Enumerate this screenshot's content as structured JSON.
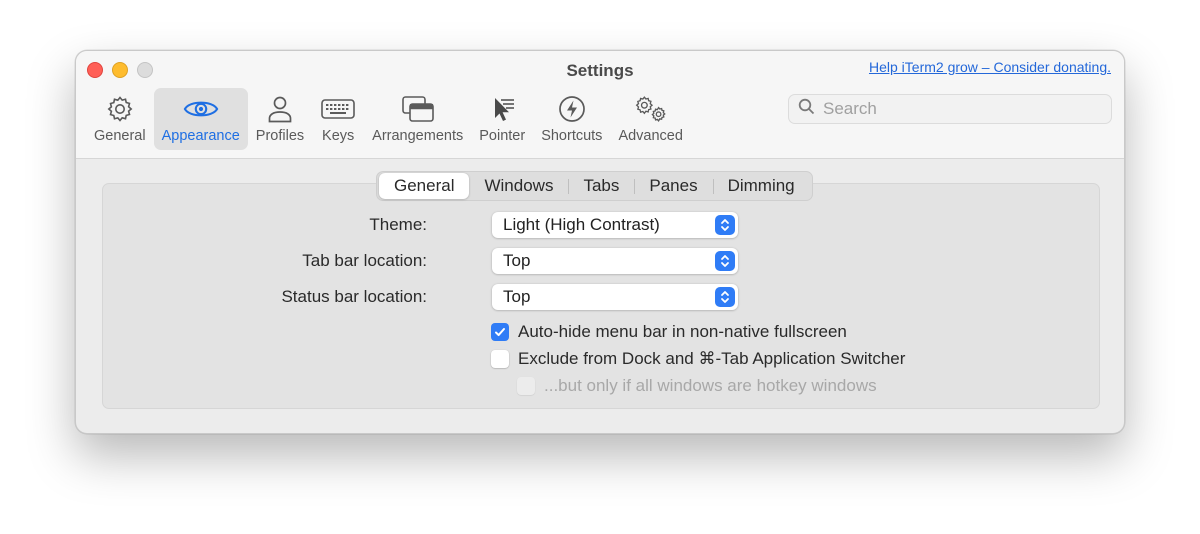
{
  "window": {
    "title": "Settings",
    "donate_link": "Help iTerm2 grow – Consider donating."
  },
  "toolbar": {
    "items": [
      {
        "label": "General",
        "icon": "gear-icon"
      },
      {
        "label": "Appearance",
        "icon": "eye-icon",
        "active": true
      },
      {
        "label": "Profiles",
        "icon": "person-icon"
      },
      {
        "label": "Keys",
        "icon": "keyboard-icon"
      },
      {
        "label": "Arrangements",
        "icon": "windows-icon"
      },
      {
        "label": "Pointer",
        "icon": "cursor-icon"
      },
      {
        "label": "Shortcuts",
        "icon": "bolt-icon"
      },
      {
        "label": "Advanced",
        "icon": "gears-icon"
      }
    ]
  },
  "search": {
    "placeholder": "Search",
    "value": ""
  },
  "tabs": {
    "items": [
      "General",
      "Windows",
      "Tabs",
      "Panes",
      "Dimming"
    ],
    "selected": "General"
  },
  "settings": {
    "theme": {
      "label": "Theme:",
      "value": "Light (High Contrast)"
    },
    "tab_bar": {
      "label": "Tab bar location:",
      "value": "Top"
    },
    "status_bar": {
      "label": "Status bar location:",
      "value": "Top"
    },
    "auto_hide": {
      "label": "Auto-hide menu bar in non-native fullscreen",
      "checked": true
    },
    "exclude_dock": {
      "label": "Exclude from Dock and ⌘-Tab Application Switcher",
      "checked": false
    },
    "hotkey_only": {
      "label": "...but only if all windows are hotkey windows",
      "checked": false,
      "disabled": true
    }
  },
  "colors": {
    "accent": "#2f7cf6",
    "link": "#2468d9",
    "close": "#ff5f57",
    "minimize": "#febc2e",
    "zoom_disabled": "#dcdcdc"
  }
}
